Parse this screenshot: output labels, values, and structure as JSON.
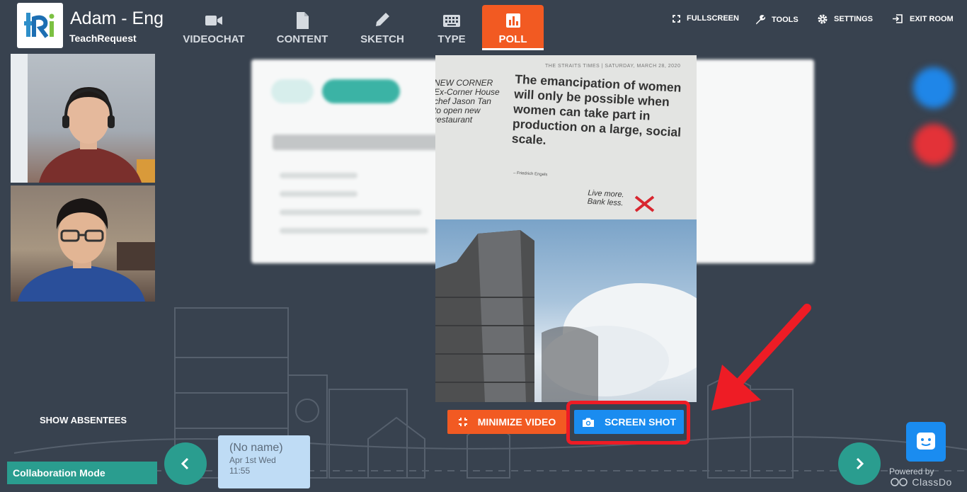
{
  "header": {
    "room_title": "Adam - Eng",
    "room_subtitle": "TeachRequest",
    "logo_text": "tRi"
  },
  "nav_tabs": [
    {
      "label": "VIDEOCHAT",
      "icon": "video-camera-icon"
    },
    {
      "label": "CONTENT",
      "icon": "document-icon"
    },
    {
      "label": "SKETCH",
      "icon": "pencil-icon"
    },
    {
      "label": "TYPE",
      "icon": "keyboard-icon"
    },
    {
      "label": "POLL",
      "icon": "bar-chart-icon",
      "active": true
    }
  ],
  "toolbar": {
    "fullscreen": "FULLSCREEN",
    "tools": "TOOLS",
    "settings": "SETTINGS",
    "exit_room": "EXIT ROOM"
  },
  "video": {
    "newspaper_header": "THE STRAITS TIMES  |  SATURDAY, MARCH 28, 2020",
    "side_text": "NEW CORNER\nEx-Corner House\nchef Jason Tan\nto open new\nrestaurant",
    "quote": "The emancipation of women will only be possible when women can take part in production on a large, social scale.",
    "attribution": "– Friedrich Engels",
    "handwriting": "Live more.\nBank less.",
    "minimize_label": "MINIMIZE VIDEO",
    "screenshot_label": "SCREEN SHOT"
  },
  "footer": {
    "show_absentees": "SHOW ABSENTEES",
    "collaboration_mode": "Collaboration Mode",
    "note": {
      "title": "(No name)",
      "date": "Apr 1st Wed",
      "time": "11:55"
    },
    "powered_by": "Powered by",
    "brand": "ClassDo"
  },
  "colors": {
    "background": "#38424f",
    "accent_orange": "#f25a22",
    "accent_blue": "#1a8cf0",
    "accent_teal": "#2a9d8f",
    "highlight_red": "#ee1c25"
  }
}
